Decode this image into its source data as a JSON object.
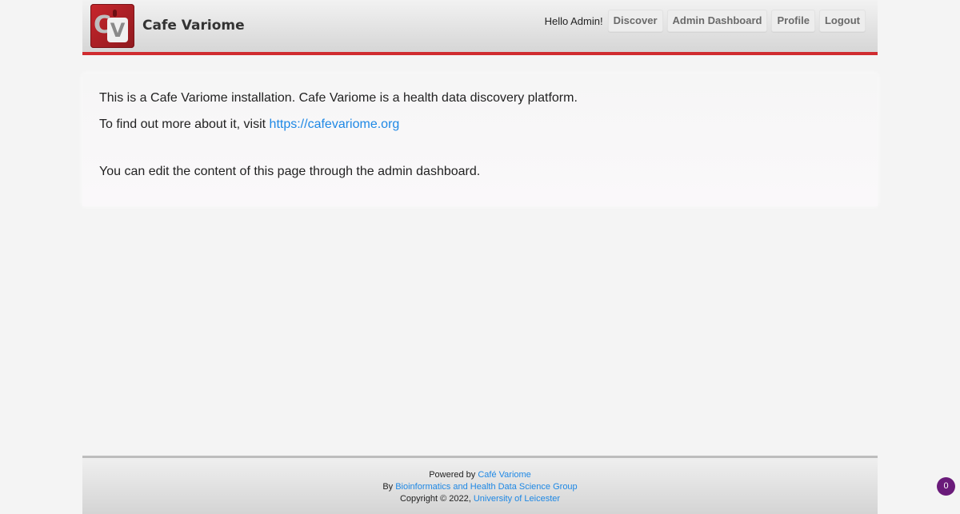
{
  "header": {
    "logo_c": "C",
    "logo_v": "V",
    "app_name": "Cafe Variome",
    "greeting": "Hello Admin!",
    "nav": [
      {
        "label": "Discover"
      },
      {
        "label": "Admin Dashboard"
      },
      {
        "label": "Profile"
      },
      {
        "label": "Logout"
      }
    ]
  },
  "main": {
    "intro_text": "This is a Cafe Variome installation. Cafe Variome is a health data discovery platform.",
    "find_out_text": "To find out more about it, visit ",
    "link_text": "https://cafevariome.org",
    "edit_text": "You can edit the content of this page through the admin dashboard."
  },
  "footer": {
    "powered_by_prefix": "Powered by ",
    "powered_by_link": "Café Variome",
    "by_prefix": "By ",
    "group_link": "Bioinformatics and Health Data Science Group",
    "copyright_prefix": "Copyright © 2022, ",
    "university_link": "University of Leicester"
  },
  "badge": {
    "count": "0"
  },
  "colors": {
    "accent": "#d02b2f",
    "link": "#1e88e5",
    "badge": "#6a1b7a"
  }
}
